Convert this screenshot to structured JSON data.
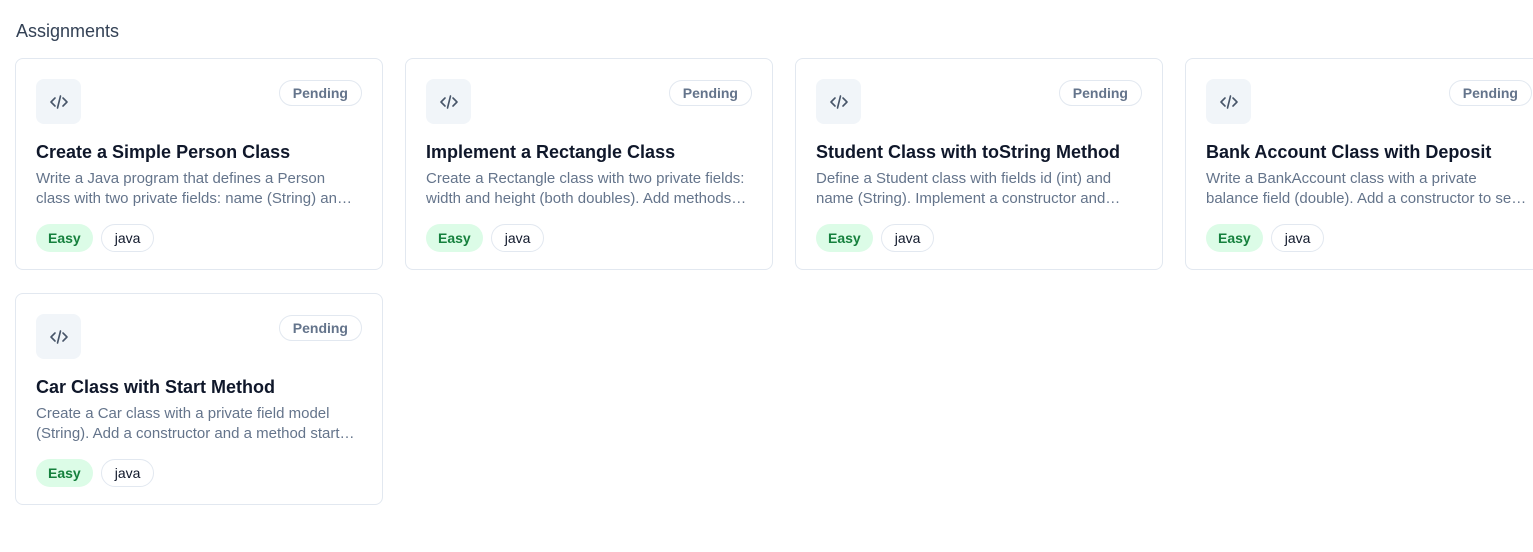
{
  "section": {
    "title": "Assignments"
  },
  "assignments": [
    {
      "status": "Pending",
      "title": "Create a Simple Person Class",
      "description": "Write a Java program that defines a Person class with two private fields: name (String) and age (int). Add a constructor and getter methods.",
      "difficulty": "Easy",
      "language": "java",
      "icon": "code-icon"
    },
    {
      "status": "Pending",
      "title": "Implement a Rectangle Class",
      "description": "Create a Rectangle class with two private fields: width and height (both doubles). Add methods to compute area and perimeter.",
      "difficulty": "Easy",
      "language": "java",
      "icon": "code-icon"
    },
    {
      "status": "Pending",
      "title": "Student Class with toString Method",
      "description": "Define a Student class with fields id (int) and name (String). Implement a constructor and override the toString method.",
      "difficulty": "Easy",
      "language": "java",
      "icon": "code-icon"
    },
    {
      "status": "Pending",
      "title": "Bank Account Class with Deposit",
      "description": "Write a BankAccount class with a private balance field (double). Add a constructor to set the initial balance and a deposit method.",
      "difficulty": "Easy",
      "language": "java",
      "icon": "code-icon"
    },
    {
      "status": "Pending",
      "title": "Car Class with Start Method",
      "description": "Create a Car class with a private field model (String). Add a constructor and a method start that prints a message.",
      "difficulty": "Easy",
      "language": "java",
      "icon": "code-icon"
    }
  ]
}
